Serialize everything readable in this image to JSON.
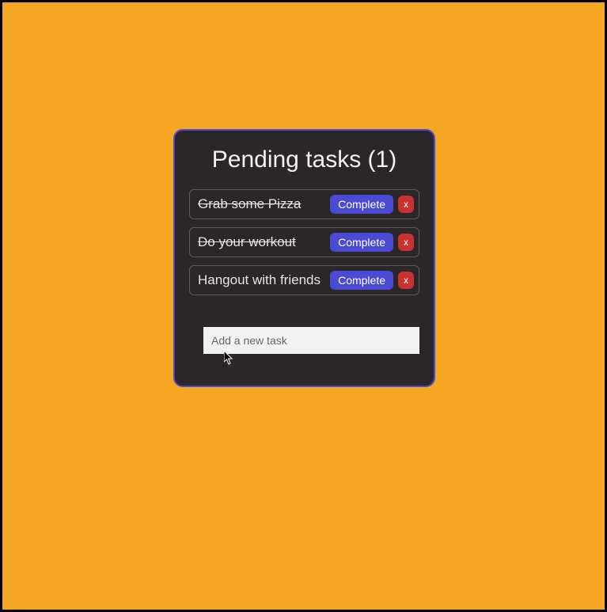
{
  "header": {
    "title_prefix": "Pending tasks",
    "pending_count": 1
  },
  "tasks": [
    {
      "text": "Grab some Pizza",
      "completed": true
    },
    {
      "text": "Do your workout",
      "completed": true
    },
    {
      "text": "Hangout with friends",
      "completed": false
    }
  ],
  "buttons": {
    "complete_label": "Complete",
    "delete_label": "x"
  },
  "input": {
    "placeholder": "Add a new task",
    "value": ""
  },
  "colors": {
    "background": "#f5a623",
    "card": "#2b2627",
    "border": "#4a4ad4",
    "complete_btn": "#4a4ad4",
    "delete_btn": "#c93030"
  }
}
